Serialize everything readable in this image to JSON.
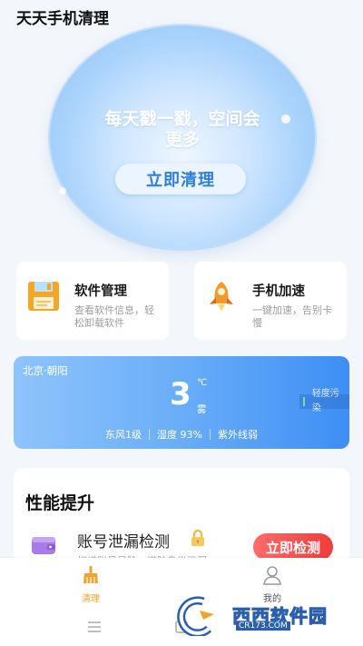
{
  "app": {
    "title": "天天手机清理"
  },
  "hero": {
    "slogan": "每天戳一戳，空间会更多",
    "clean_button": "立即清理"
  },
  "features": [
    {
      "title": "软件管理",
      "desc": "查看软件信息，轻松卸载软件",
      "icon": "floppy-disk-icon"
    },
    {
      "title": "手机加速",
      "desc": "一键加速，告别卡慢",
      "icon": "rocket-icon"
    }
  ],
  "weather": {
    "location": "北京·朝阳",
    "temperature": "3",
    "unit": "℃",
    "condition": "雾",
    "aqi": "轻度污染",
    "wind": "东风1级",
    "humidity": "湿度 93%",
    "uv": "紫外线弱"
  },
  "performance": {
    "heading": "性能提升",
    "item": {
      "title": "账号泄漏检测",
      "desc": "扫描账号风险，谨防身份泄漏",
      "button": "立即检测"
    }
  },
  "nav": {
    "items": [
      {
        "label": "清理",
        "icon": "broom-icon",
        "active": true
      },
      {
        "label": "我的",
        "icon": "user-icon",
        "active": false
      }
    ]
  },
  "watermark": {
    "text": "西西软件园",
    "url": "CR173.COM"
  },
  "colors": {
    "accent_blue": "#2f7fe0",
    "weather_gradient_end": "#3d8ef5",
    "detect_red": "#ef3c3c",
    "nav_active": "#f0a42b"
  }
}
